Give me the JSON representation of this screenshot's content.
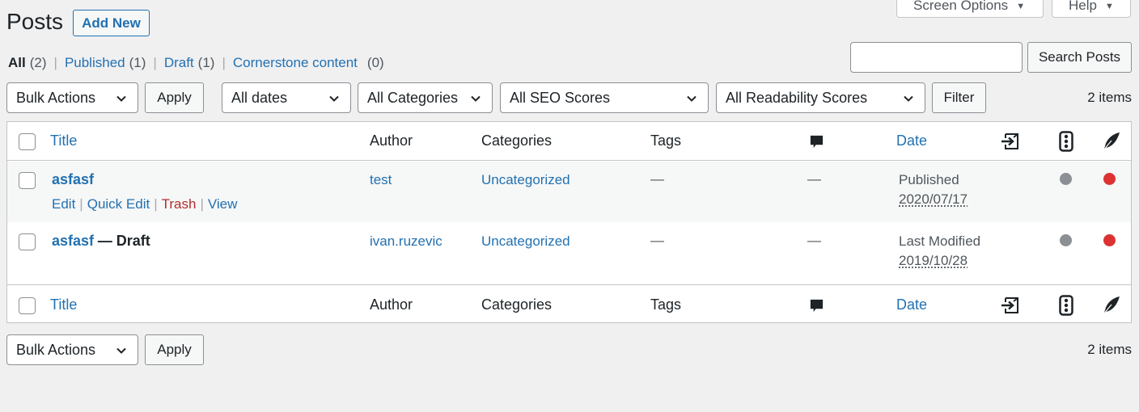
{
  "header": {
    "title": "Posts",
    "add_new": "Add New",
    "screen_options": "Screen Options",
    "help": "Help"
  },
  "views": [
    {
      "label": "All",
      "count": "(2)"
    },
    {
      "label": "Published",
      "count": "(1)"
    },
    {
      "label": "Draft",
      "count": "(1)"
    },
    {
      "label": "Cornerstone content",
      "count": "(0)"
    }
  ],
  "search": {
    "value": "",
    "button": "Search Posts"
  },
  "filters": {
    "bulk_actions": "Bulk Actions",
    "apply": "Apply",
    "dates": "All dates",
    "categories": "All Categories",
    "seo": "All SEO Scores",
    "readability": "All Readability Scores",
    "filter": "Filter",
    "items": "2 items"
  },
  "columns": {
    "title": "Title",
    "author": "Author",
    "categories": "Categories",
    "tags": "Tags",
    "date": "Date"
  },
  "icons": {
    "comments": "comment-bubble-icon",
    "links": "internal-links-icon",
    "seo": "traffic-light-icon",
    "readability": "quill-icon"
  },
  "rows": [
    {
      "title": "asfasf",
      "state": "",
      "author": "test",
      "categories": "Uncategorized",
      "tags": "—",
      "comments": "—",
      "date_status": "Published",
      "date": "2020/07/17",
      "seo_color": "#8c8f94",
      "readability_color": "#dc3232",
      "actions": {
        "edit": "Edit",
        "quick_edit": "Quick Edit",
        "trash": "Trash",
        "view": "View"
      }
    },
    {
      "title": "asfasf",
      "state": "— Draft",
      "author": "ivan.ruzevic",
      "categories": "Uncategorized",
      "tags": "—",
      "comments": "—",
      "date_status": "Last Modified",
      "date": "2019/10/28",
      "seo_color": "#8c8f94",
      "readability_color": "#dc3232"
    }
  ],
  "bottom": {
    "bulk_actions": "Bulk Actions",
    "apply": "Apply",
    "items": "2 items"
  },
  "colors": {
    "link": "#2271b1",
    "trash": "#b32d2e",
    "bad": "#dc3232",
    "neutral": "#8c8f94"
  }
}
